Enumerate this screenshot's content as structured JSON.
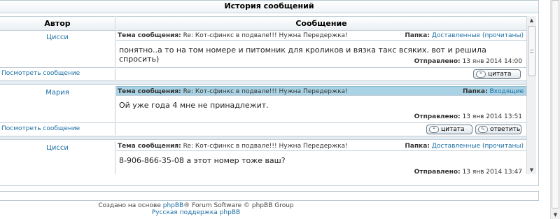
{
  "caption": "История сообщений",
  "columns": {
    "author": "Автор",
    "message": "Сообщение"
  },
  "labels": {
    "topic": "Тема сообщения:",
    "folder": "Папка:",
    "sent": "Отправлено:",
    "view_message": "Посмотреть сообщение",
    "quote": "цитата",
    "reply": "ответить"
  },
  "posts": [
    {
      "author": "Цисси",
      "topic": "Re: Кот-сфинкс в подвале!!! Нужна Передержка!",
      "folder": "Доставленные (прочитаны)",
      "text": "понятно..а то на том номере и питомник для кроликов и вязка такс всяких. вот и решила спросить)",
      "sent": "13 янв 2014 14:00"
    },
    {
      "author": "Мария",
      "topic": "Re: Кот-сфинкс в подвале!!! Нужна Передержка!",
      "folder": "Входящие",
      "text": "Ой уже года 4 мне не принадлежит.",
      "sent": "13 янв 2014 13:51"
    },
    {
      "author": "Цисси",
      "topic": "Re: Кот-сфинкс в подвале!!! Нужна Передержка!",
      "folder": "Доставленные (прочитаны)",
      "text": "8-906-866-35-08 а этот номер тоже ваш?",
      "sent": "13 янв 2014 13:47"
    }
  ],
  "footer": {
    "created_on": "Создано на основе",
    "phpbb": "phpBB",
    "rest": "® Forum Software © phpBB Group",
    "support": "Русская поддержка phpBB"
  },
  "icons": {
    "quote": "quote-icon",
    "reply": "reply-icon"
  }
}
